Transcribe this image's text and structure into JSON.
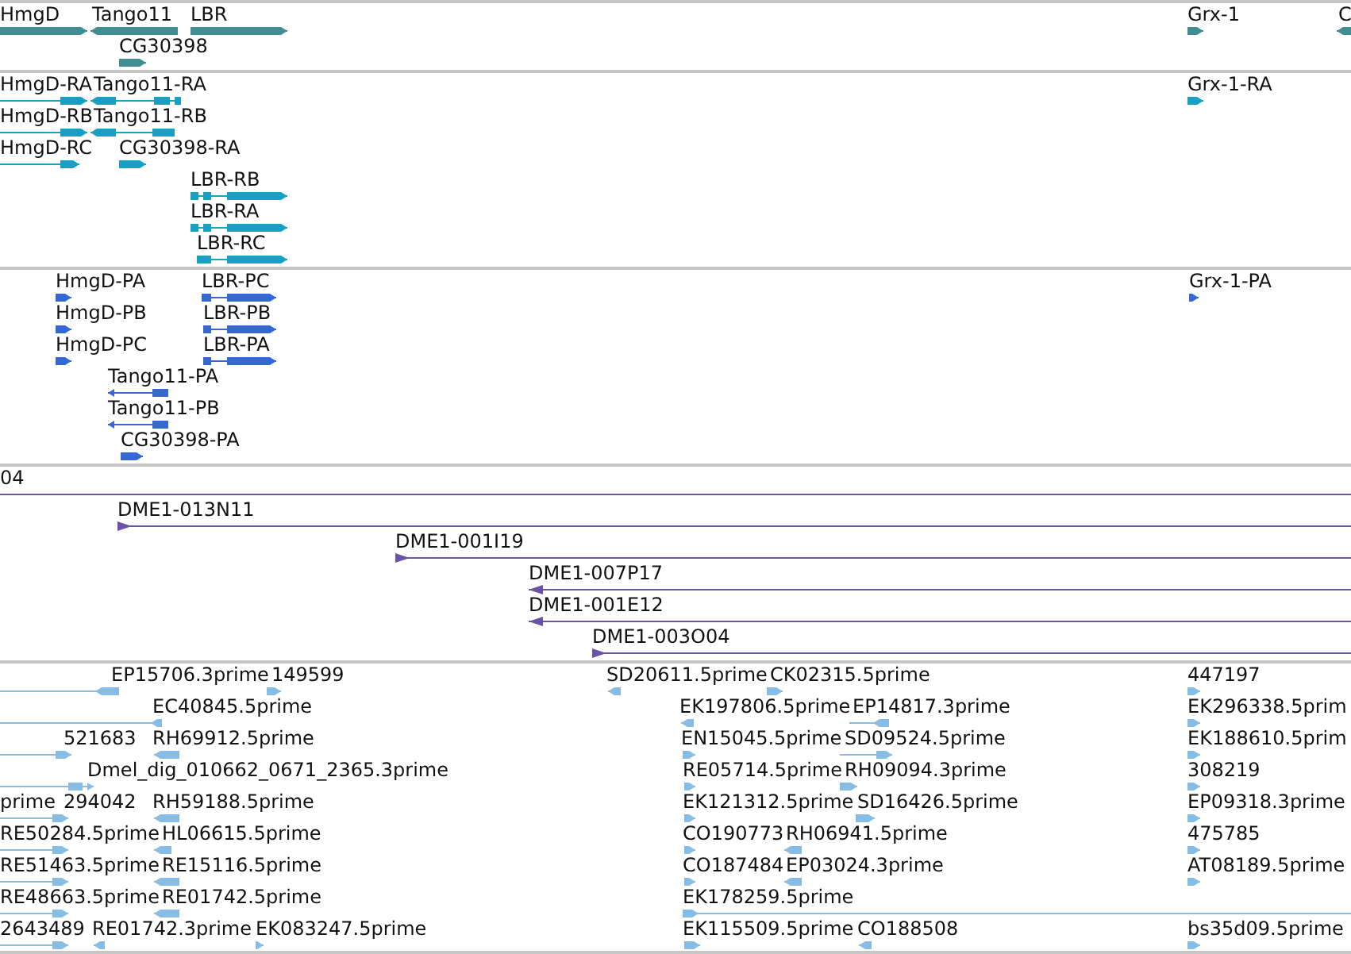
{
  "tracks": [
    {
      "kind": "gene",
      "color": "#408e91",
      "features": [
        {
          "label": "HmgD",
          "reverse": false
        },
        {
          "label": "Tango11",
          "reverse": true
        },
        {
          "label": "LBR",
          "reverse": false
        },
        {
          "label": "Grx-1",
          "reverse": false
        },
        {
          "label": "C",
          "reverse": true
        },
        {
          "label": "CG30398",
          "reverse": false
        }
      ]
    },
    {
      "kind": "transcript",
      "color": "#18a0c4",
      "features": [
        {
          "label": "HmgD-RA",
          "reverse": false
        },
        {
          "label": "Tango11-RA",
          "reverse": true
        },
        {
          "label": "Grx-1-RA",
          "reverse": false
        },
        {
          "label": "HmgD-RB",
          "reverse": false
        },
        {
          "label": "Tango11-RB",
          "reverse": true
        },
        {
          "label": "HmgD-RC",
          "reverse": false
        },
        {
          "label": "CG30398-RA",
          "reverse": false
        },
        {
          "label": "LBR-RB",
          "reverse": false
        },
        {
          "label": "LBR-RA",
          "reverse": false
        },
        {
          "label": "LBR-RC",
          "reverse": false
        }
      ]
    },
    {
      "kind": "protein",
      "color": "#3568d4",
      "features": [
        {
          "label": "HmgD-PA",
          "reverse": false
        },
        {
          "label": "LBR-PC",
          "reverse": false
        },
        {
          "label": "Grx-1-PA",
          "reverse": false
        },
        {
          "label": "HmgD-PB",
          "reverse": false
        },
        {
          "label": "LBR-PB",
          "reverse": false
        },
        {
          "label": "HmgD-PC",
          "reverse": false
        },
        {
          "label": "LBR-PA",
          "reverse": false
        },
        {
          "label": "Tango11-PA",
          "reverse": true
        },
        {
          "label": "Tango11-PB",
          "reverse": true
        },
        {
          "label": "CG30398-PA",
          "reverse": false
        }
      ]
    },
    {
      "kind": "clone",
      "color": "#6c52a4",
      "features": [
        {
          "label": "04"
        },
        {
          "label": "DME1-013N11",
          "reverse": false
        },
        {
          "label": "DME1-001I19",
          "reverse": false
        },
        {
          "label": "DME1-007P17",
          "reverse": true
        },
        {
          "label": "DME1-001E12",
          "reverse": true
        },
        {
          "label": "DME1-003O04",
          "reverse": false
        }
      ]
    },
    {
      "kind": "est",
      "color": "#87bde4",
      "features": [
        {
          "label": "EP15706.3prime",
          "reverse": true
        },
        {
          "label": "149599",
          "reverse": false
        },
        {
          "label": "SD20611.5prime",
          "reverse": true
        },
        {
          "label": "CK02315.5prime",
          "reverse": false
        },
        {
          "label": "447197",
          "reverse": false
        },
        {
          "label": "EC40845.5prime",
          "reverse": true
        },
        {
          "label": "EK197806.5prime",
          "reverse": true
        },
        {
          "label": "EP14817.3prime",
          "reverse": true
        },
        {
          "label": "EK296338.5prim",
          "reverse": false
        },
        {
          "label": "521683",
          "reverse": false
        },
        {
          "label": "RH69912.5prime",
          "reverse": true
        },
        {
          "label": "EN15045.5prime",
          "reverse": false
        },
        {
          "label": "SD09524.5prime",
          "reverse": false
        },
        {
          "label": "EK188610.5prim",
          "reverse": false
        },
        {
          "label": "Dmel_dig_010662_0671_2365.3prime",
          "reverse": false
        },
        {
          "label": "RE05714.5prime",
          "reverse": false
        },
        {
          "label": "RH09094.3prime",
          "reverse": false
        },
        {
          "label": "308219",
          "reverse": false
        },
        {
          "label": "prime",
          "reverse": false
        },
        {
          "label": "294042"
        },
        {
          "label": "RH59188.5prime",
          "reverse": true
        },
        {
          "label": "EK121312.5prime",
          "reverse": false
        },
        {
          "label": "SD16426.5prime",
          "reverse": false
        },
        {
          "label": "EP09318.3prime",
          "reverse": false
        },
        {
          "label": "RE50284.5prime",
          "reverse": false
        },
        {
          "label": "HL06615.5prime",
          "reverse": true
        },
        {
          "label": "CO190773",
          "reverse": false
        },
        {
          "label": "RH06941.5prime",
          "reverse": true
        },
        {
          "label": "475785",
          "reverse": false
        },
        {
          "label": "RE51463.5prime",
          "reverse": false
        },
        {
          "label": "RE15116.5prime",
          "reverse": true
        },
        {
          "label": "CO187484",
          "reverse": false
        },
        {
          "label": "EP03024.3prime",
          "reverse": true
        },
        {
          "label": "AT08189.5prime",
          "reverse": false
        },
        {
          "label": "RE48663.5prime",
          "reverse": false
        },
        {
          "label": "RE01742.5prime",
          "reverse": true
        },
        {
          "label": "EK178259.5prime",
          "reverse": false
        },
        {
          "label": "2643489",
          "reverse": false
        },
        {
          "label": "RE01742.3prime",
          "reverse": true
        },
        {
          "label": "EK083247.5prime",
          "reverse": false
        },
        {
          "label": "EK115509.5prime",
          "reverse": false
        },
        {
          "label": "CO188508",
          "reverse": true
        },
        {
          "label": "bs35d09.5prime",
          "reverse": false
        }
      ]
    }
  ]
}
